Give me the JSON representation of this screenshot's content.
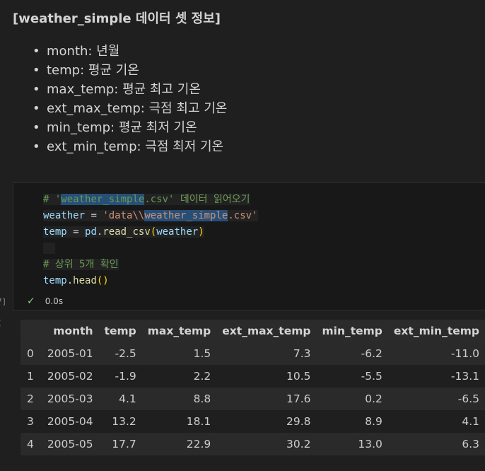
{
  "markdown": {
    "title": "[weather_simple 데이터 셋 정보]",
    "bullets": [
      "month: 년월",
      "temp: 평균 기온",
      "max_temp: 평균 최고 기온",
      "ext_max_temp: 극점 최고 기온",
      "min_temp: 평균 최저 기온",
      "ext_min_temp: 극점 최저 기온"
    ]
  },
  "code_cell": {
    "lines": {
      "l1_hash": "# ",
      "l1_q1": "'",
      "l1_name": "weather_simple",
      "l1_ext": ".csv'",
      "l1_rest": " 데이터 읽어오기",
      "l2_var": "weather",
      "l2_eq": " = ",
      "l2_str1": "'data\\\\",
      "l2_str2": "weather_simple",
      "l2_str3": ".csv'",
      "l3_var": "temp",
      "l3_eq": " = ",
      "l3_mod": "pd",
      "l3_dot": ".",
      "l3_fn": "read_csv",
      "l3_open": "(",
      "l3_arg": "weather",
      "l3_close": ")",
      "l5_comment": "# 상위 5개 확인",
      "l6_var": "temp",
      "l6_dot": ".",
      "l6_fn": "head",
      "l6_parens": "()"
    },
    "gutter_number": "7]",
    "status_time": "0.0s",
    "status_icon": "check-icon"
  },
  "output": {
    "marker": "[",
    "columns": [
      "",
      "month",
      "temp",
      "max_temp",
      "ext_max_temp",
      "min_temp",
      "ext_min_temp"
    ],
    "rows": [
      [
        "0",
        "2005-01",
        "-2.5",
        "1.5",
        "7.3",
        "-6.2",
        "-11.0"
      ],
      [
        "1",
        "2005-02",
        "-1.9",
        "2.2",
        "10.5",
        "-5.5",
        "-13.1"
      ],
      [
        "2",
        "2005-03",
        "4.1",
        "8.8",
        "17.6",
        "0.2",
        "-6.5"
      ],
      [
        "3",
        "2005-04",
        "13.2",
        "18.1",
        "29.8",
        "8.9",
        "4.1"
      ],
      [
        "4",
        "2005-05",
        "17.7",
        "22.9",
        "30.2",
        "13.0",
        "6.3"
      ]
    ]
  },
  "colors": {
    "background": "#1f1f1f",
    "selection": "#264f78",
    "success": "#89d185"
  }
}
